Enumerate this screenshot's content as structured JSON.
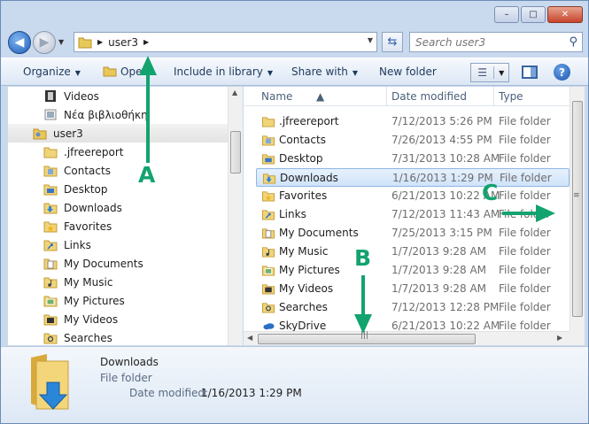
{
  "window": {
    "caption_buttons": {
      "minimize": "–",
      "maximize": "□",
      "close": "✕"
    }
  },
  "address": {
    "path": [
      "user3"
    ],
    "search_placeholder": "Search user3"
  },
  "toolbar": {
    "organize": "Organize",
    "open": "Open",
    "include_in_library": "Include in library",
    "share_with": "Share with",
    "new_folder": "New folder"
  },
  "nav": {
    "items": [
      {
        "label": "Videos",
        "icon": "videos-library-icon"
      },
      {
        "label": "Νέα βιβλιοθήκη",
        "icon": "new-library-icon"
      },
      {
        "label": "user3",
        "icon": "user-folder-icon",
        "selected": true
      },
      {
        "label": ".jfreereport",
        "icon": "folder-icon"
      },
      {
        "label": "Contacts",
        "icon": "contacts-folder-icon"
      },
      {
        "label": "Desktop",
        "icon": "desktop-folder-icon"
      },
      {
        "label": "Downloads",
        "icon": "downloads-folder-icon"
      },
      {
        "label": "Favorites",
        "icon": "favorites-folder-icon"
      },
      {
        "label": "Links",
        "icon": "links-folder-icon"
      },
      {
        "label": "My Documents",
        "icon": "documents-folder-icon"
      },
      {
        "label": "My Music",
        "icon": "music-folder-icon"
      },
      {
        "label": "My Pictures",
        "icon": "pictures-folder-icon"
      },
      {
        "label": "My Videos",
        "icon": "videos-folder-icon"
      },
      {
        "label": "Searches",
        "icon": "searches-folder-icon"
      }
    ]
  },
  "files": {
    "columns": {
      "name": "Name",
      "date": "Date modified",
      "type": "Type"
    },
    "rows": [
      {
        "name": ".jfreereport",
        "date": "7/12/2013 5:26 PM",
        "type": "File folder"
      },
      {
        "name": "Contacts",
        "date": "7/26/2013 4:55 PM",
        "type": "File folder"
      },
      {
        "name": "Desktop",
        "date": "7/31/2013 10:28 AM",
        "type": "File folder"
      },
      {
        "name": "Downloads",
        "date": "1/16/2013 1:29 PM",
        "type": "File folder",
        "selected": true
      },
      {
        "name": "Favorites",
        "date": "6/21/2013 10:22 AM",
        "type": "File folder"
      },
      {
        "name": "Links",
        "date": "7/12/2013 11:43 AM",
        "type": "File folder"
      },
      {
        "name": "My Documents",
        "date": "7/25/2013 3:15 PM",
        "type": "File folder"
      },
      {
        "name": "My Music",
        "date": "1/7/2013 9:28 AM",
        "type": "File folder"
      },
      {
        "name": "My Pictures",
        "date": "1/7/2013 9:28 AM",
        "type": "File folder"
      },
      {
        "name": "My Videos",
        "date": "1/7/2013 9:28 AM",
        "type": "File folder"
      },
      {
        "name": "Searches",
        "date": "7/12/2013 12:28 PM",
        "type": "File folder"
      },
      {
        "name": "SkyDrive",
        "date": "6/21/2013 10:22 AM",
        "type": "File folder"
      }
    ]
  },
  "details": {
    "name": "Downloads",
    "type": "File folder",
    "date_label": "Date modified:",
    "date": "1/16/2013 1:29 PM"
  },
  "annotations": {
    "a": "A",
    "b": "B",
    "c": "C",
    "color": "#13a36e"
  }
}
